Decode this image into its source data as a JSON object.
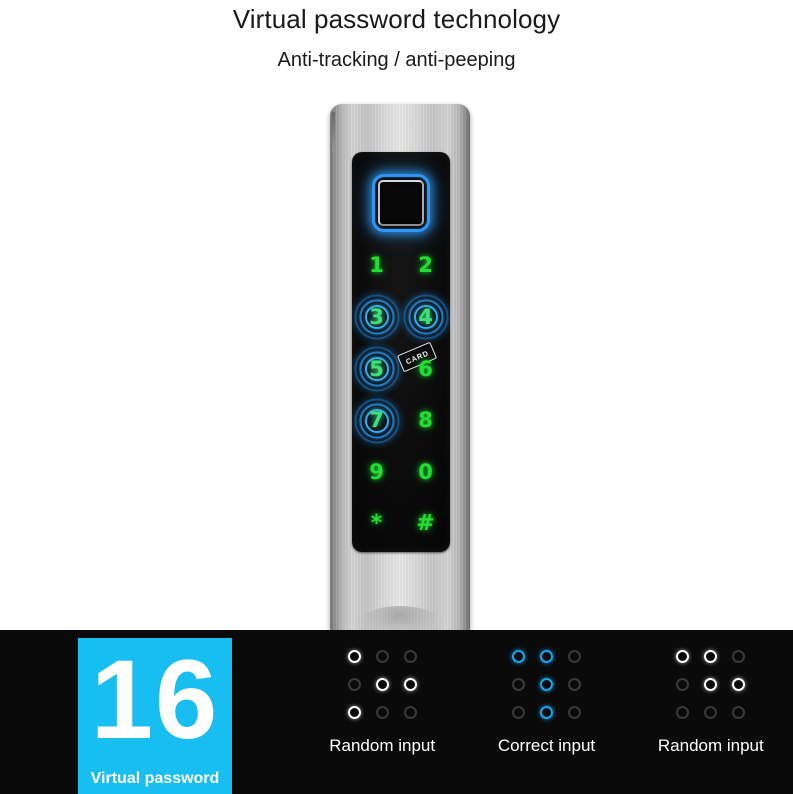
{
  "heading": {
    "title": "Virtual password technology",
    "subtitle": "Anti-tracking / anti-peeping"
  },
  "device": {
    "name": "smart-door-lock",
    "fingerprint_sensor": "fingerprint-sensor",
    "card_tag_label": "CARD",
    "keypad": [
      {
        "label": "1",
        "active": false
      },
      {
        "label": "2",
        "active": false
      },
      {
        "label": "3",
        "active": true
      },
      {
        "label": "4",
        "active": true
      },
      {
        "label": "5",
        "active": true
      },
      {
        "label": "6",
        "active": false
      },
      {
        "label": "7",
        "active": true
      },
      {
        "label": "8",
        "active": false
      },
      {
        "label": "9",
        "active": false
      },
      {
        "label": "0",
        "active": false
      },
      {
        "label": "*",
        "active": false
      },
      {
        "label": "#",
        "active": false
      }
    ],
    "colors": {
      "key_green": "#22dd33",
      "ripple_blue": "#2996eb",
      "sensor_blue": "#2f95f0"
    }
  },
  "banner": {
    "badge": {
      "number": "16",
      "caption": "Virtual password",
      "color": "#19bef0"
    },
    "groups": [
      {
        "label": "Random input",
        "state": "white",
        "dots": [
          [
            "on",
            "off",
            "off"
          ],
          [
            "off",
            "on",
            "on"
          ],
          [
            "on",
            "off",
            "off"
          ]
        ]
      },
      {
        "label": "Correct input",
        "state": "blue",
        "dots": [
          [
            "on",
            "on",
            "off"
          ],
          [
            "off",
            "on",
            "off"
          ],
          [
            "off",
            "on",
            "off"
          ]
        ]
      },
      {
        "label": "Random input",
        "state": "white",
        "dots": [
          [
            "on",
            "on",
            "off"
          ],
          [
            "off",
            "on",
            "on"
          ],
          [
            "off",
            "off",
            "off"
          ]
        ]
      }
    ]
  }
}
